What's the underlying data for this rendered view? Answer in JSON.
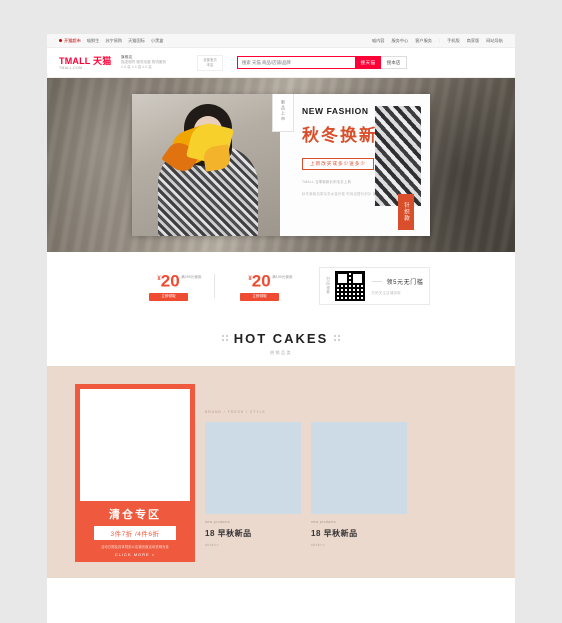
{
  "topbar": {
    "left": [
      "开猫超市",
      "喵鲜生",
      "苏宁易购",
      "天猫国际",
      "小黑盒"
    ],
    "left_highlight": "开猫超市",
    "right": [
      "喵内容",
      "服务中心",
      "客户服务",
      "手机版",
      "商家版",
      "网站导航"
    ]
  },
  "header": {
    "logo_main": "TMALL 天猫",
    "logo_sub": "TMALL.COM",
    "shop_row1": "旗舰店",
    "shop_row2": "关注店铺",
    "shop_row3": "店铺动态评分与同行业相比",
    "shop_extra": "描述相符 服务态度 物流服务",
    "shop_scores": "4.8 高 4.8 高 4.8 高",
    "category_line1": "全部宝贝",
    "category_line2": "本店",
    "search_value": "搜索 天猫 商品/店铺/品牌",
    "search_button": "搜天猫",
    "search_button2": "搜本店"
  },
  "hero": {
    "ribbon": "新品上市",
    "title_en": "NEW FASHION",
    "title_cn": "秋冬换新",
    "sub_pill": "上新改买或多少送多少",
    "fine_note": "TMALL  当季新款针织毛衫上新",
    "fine_list": "秋冬新款加厚毛衣女装外套\n时尚百搭针织衫\n潮流韩版宽松毛衣",
    "swatch_label": "针织款"
  },
  "coupons": {
    "items": [
      {
        "symbol": "¥",
        "amount": "20",
        "condition": "满299元使用",
        "button": "立即领取"
      },
      {
        "symbol": "¥",
        "amount": "20",
        "condition": "满199元使用",
        "button": "立即领取"
      }
    ],
    "qr_side": "扫码领券",
    "qr_main": "领5元无门槛",
    "qr_sub": "扫码关注店铺领取"
  },
  "hotcakes": {
    "title": "HOT CAKES",
    "subtitle": "热销品类"
  },
  "products": {
    "big": {
      "title": "清仓专区",
      "pill": "3件7折 /4件6折",
      "note": "活动日期及具体规则以店铺页面活动说明为准",
      "more": "CLICK MORE >"
    },
    "breadcrumb": "BRAND / FRESH / STYLE",
    "cards": [
      {
        "en": "new products",
        "cn": "18 早秋新品",
        "click": "click>>"
      },
      {
        "en": "new products",
        "cn": "18 早秋新品",
        "click": "click>>"
      }
    ]
  }
}
